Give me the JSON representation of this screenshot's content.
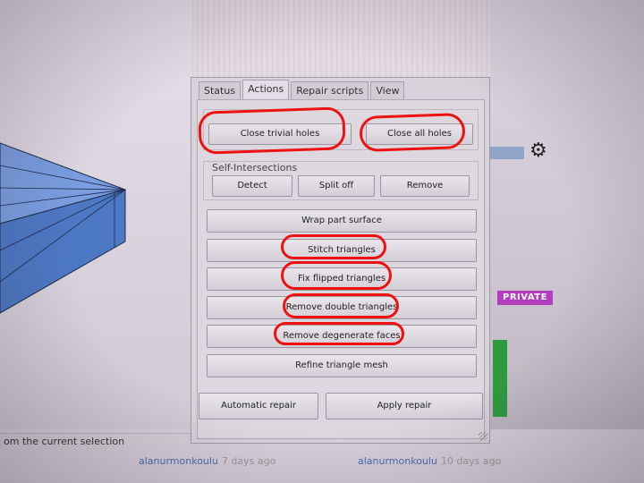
{
  "dialog": {
    "tabs": [
      {
        "label": "Status",
        "active": false
      },
      {
        "label": "Actions",
        "active": true
      },
      {
        "label": "Repair scripts",
        "active": false
      },
      {
        "label": "View",
        "active": false
      }
    ],
    "holes_buttons": {
      "close_trivial": "Close trivial holes",
      "close_all": "Close all holes"
    },
    "self_intersections": {
      "label": "Self-Intersections",
      "detect": "Detect",
      "split_off": "Split off",
      "remove": "Remove"
    },
    "actions": [
      "Wrap part surface",
      "Stitch triangles",
      "Fix flipped triangles",
      "Remove double triangles",
      "Remove degenerate faces",
      "Refine triangle mesh"
    ],
    "footer": {
      "automatic_repair": "Automatic repair",
      "apply_repair": "Apply repair"
    }
  },
  "background": {
    "status_text": "om the current selection",
    "private_badge": "PRIVATE",
    "users": [
      {
        "name": "alanurmonkoulu",
        "ago": "7 days ago"
      },
      {
        "name": "alanurmonkoulu",
        "ago": "10 days ago"
      }
    ]
  },
  "colors": {
    "highlight": "#ee1111",
    "model_blue": "#5a86d0",
    "private": "#b23dbf",
    "progress": "#2e9a3e"
  },
  "icons": {
    "settings": "gear-icon"
  }
}
